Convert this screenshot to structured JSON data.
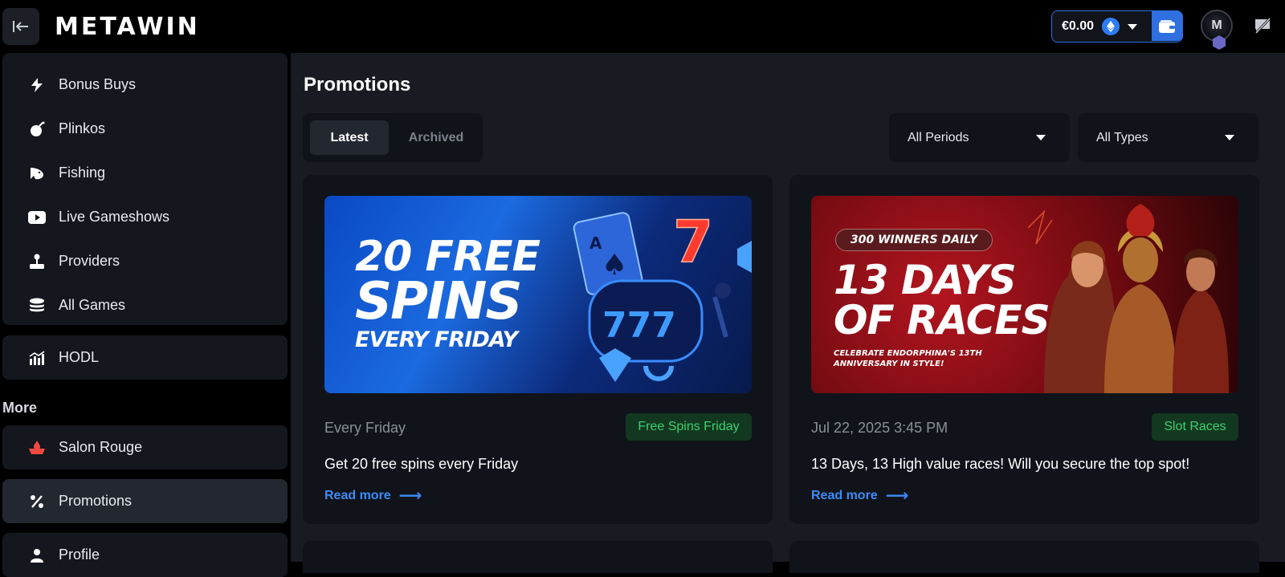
{
  "app": {
    "logo_text": "METAWIN",
    "accent_color": "#2f6fe0"
  },
  "topbar": {
    "balance": "€0.00",
    "currency_icon": "ethereum-icon",
    "avatar_text": "M"
  },
  "sidebar": {
    "group1": [
      {
        "label": "Bonus Buys",
        "icon": "lightning-icon"
      },
      {
        "label": "Plinkos",
        "icon": "bomb-icon"
      },
      {
        "label": "Fishing",
        "icon": "fish-icon"
      },
      {
        "label": "Live Gameshows",
        "icon": "play-icon"
      },
      {
        "label": "Providers",
        "icon": "joystick-icon"
      },
      {
        "label": "All Games",
        "icon": "stack-icon"
      }
    ],
    "hodl": {
      "label": "HODL",
      "icon": "chart-icon"
    },
    "more_heading": "More",
    "salon": {
      "label": "Salon Rouge",
      "icon": "salon-icon"
    },
    "promotions": {
      "label": "Promotions",
      "icon": "percent-icon"
    },
    "profile": {
      "label": "Profile",
      "icon": "user-icon"
    }
  },
  "main": {
    "title": "Promotions",
    "tabs": [
      {
        "label": "Latest",
        "active": true
      },
      {
        "label": "Archived",
        "active": false
      }
    ],
    "filters": {
      "period": "All Periods",
      "type": "All Types"
    },
    "cards": [
      {
        "art": {
          "line1": "20 FREE",
          "line2": "SPINS",
          "line3": "EVERY FRIDAY"
        },
        "date": "Every Friday",
        "badge": "Free Spins Friday",
        "description": "Get 20 free spins every Friday",
        "link": "Read more"
      },
      {
        "art": {
          "pill": "300 WINNERS DAILY",
          "line1": "13 DAYS",
          "line2": "OF RACES",
          "line3": "CELEBRATE ENDORPHINA'S 13TH ANNIVERSARY IN STYLE!"
        },
        "date": "Jul 22, 2025 3:45 PM",
        "badge": "Slot Races",
        "description": "13 Days, 13 High value races! Will you secure the top spot!",
        "link": "Read more"
      }
    ]
  }
}
